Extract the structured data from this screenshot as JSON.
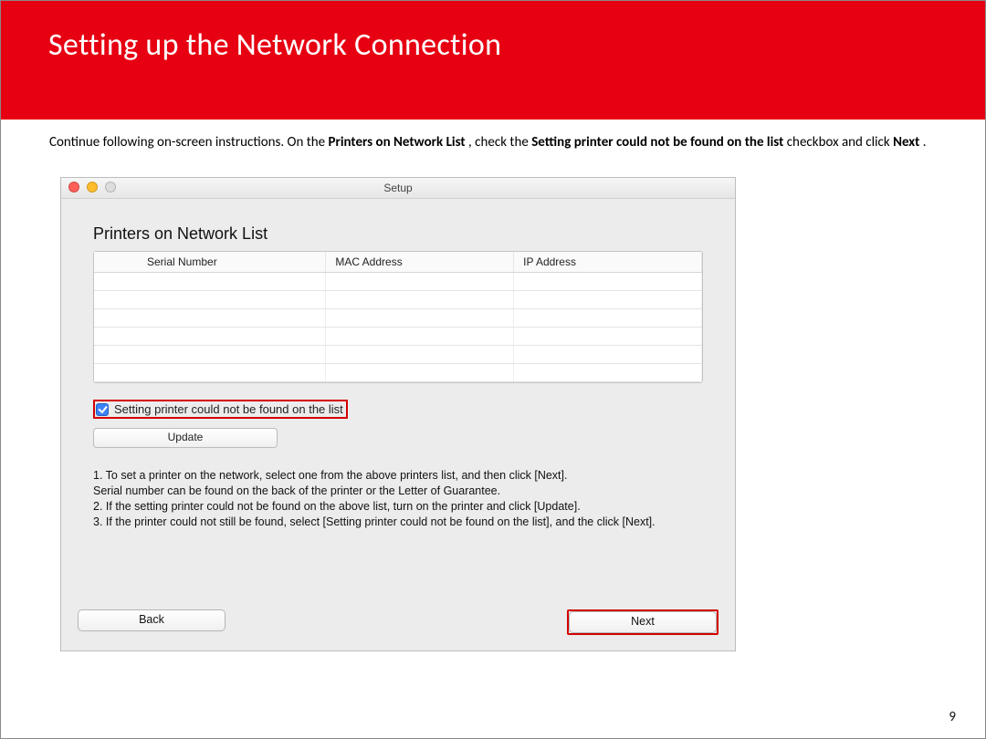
{
  "slide": {
    "title": "Setting up the Network Connection",
    "page_number": "9"
  },
  "intro": {
    "prefix": "Continue following on-screen instructions.  On the ",
    "bold1": "Printers on Network List",
    "mid1": ", check the ",
    "bold2": "Setting printer could not be found on the list",
    "mid2": " checkbox and click ",
    "bold3": "Next",
    "suffix": "."
  },
  "window": {
    "title": "Setup",
    "heading": "Printers on Network List",
    "columns": {
      "serial": "Serial Number",
      "mac": "MAC Address",
      "ip": "IP Address"
    },
    "checkbox_label": "Setting printer could not be found on the list",
    "update_label": "Update",
    "instructions": {
      "l1": "1. To set a printer on the network, select one from the above printers list, and then click [Next].",
      "l2": "Serial number can be found on the back of the printer or the Letter of Guarantee.",
      "l3": "2. If the setting printer could not be found on the above list, turn on the printer and click [Update].",
      "l4": "3. If the printer could not still be found, select [Setting printer could not be found on the list], and the click [Next]."
    },
    "buttons": {
      "back": "Back",
      "next": "Next"
    }
  }
}
